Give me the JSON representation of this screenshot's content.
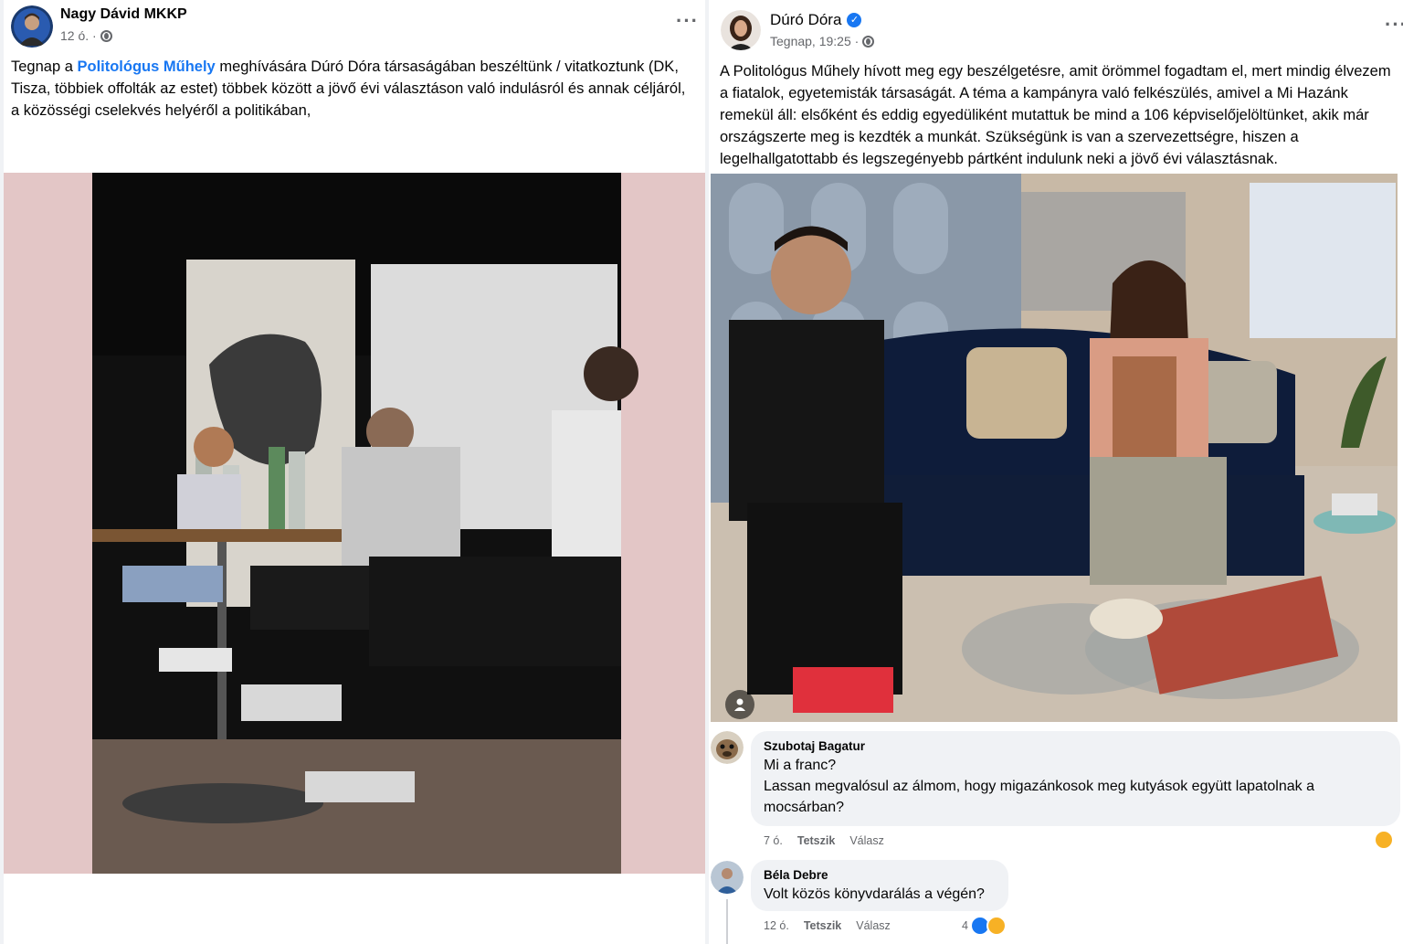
{
  "left_post": {
    "author": "Nagy Dávid MKKP",
    "time": "12 ó. ·",
    "text_before_link": "Tegnap a ",
    "link": "Politológus Műhely",
    "text_after_link": " meghívására Dúró Dóra társaságában beszéltünk / vitatkoztunk (DK, Tisza, többiek offolták az estet) többek között a jövő évi választáson való indulásról és annak céljáról, a közösségi cselekvés helyéről a politikában,",
    "more_label": "···"
  },
  "right_post": {
    "author": "Dúró Dóra",
    "verified_mark": "✓",
    "time": "Tegnap, 19:25 ·",
    "text": "A Politológus Műhely hívott meg egy beszélgetésre, amit örömmel fogadtam el, mert mindig élvezem a fiatalok, egyetemisták társaságát. A téma a kampányra való felkészülés, amivel a Mi Hazánk remekül áll: elsőként és eddig egyedüliként mutattuk be mind a 106 képviselőjelöltünket, akik már országszerte meg is kezdték a munkát. Szükségünk is van a szervezettségre, hiszen a legelhallgatottabb és legszegényebb pártként indulunk neki a jövő évi választásnak.",
    "more_label": "···"
  },
  "comments": [
    {
      "name": "Szubotaj Bagatur",
      "lines": [
        "Mi a franc?",
        "Lassan megvalósul az álmom, hogy migazánkosok meg kutyások együtt lapatolnak a",
        "mocsárban?"
      ],
      "time": "7 ó.",
      "like": "Tetszik",
      "reply": "Válasz"
    },
    {
      "name": "Béla Debre",
      "lines": [
        "Volt közös könyvdarálás a végén?"
      ],
      "time": "12 ó.",
      "like": "Tetszik",
      "reply": "Válasz",
      "reactions": "4"
    }
  ],
  "icons": [
    "globe-icon",
    "verified-icon",
    "more-options-icon",
    "tag-person-icon",
    "laugh-reaction-icon",
    "like-reaction-icon"
  ]
}
